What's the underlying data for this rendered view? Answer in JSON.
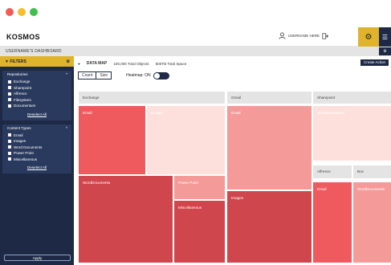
{
  "app": {
    "logo": "KOSMOS",
    "username": "USERNAME HERE",
    "dashboard_title": "USERNAME'S DASHBOARD"
  },
  "colors": {
    "navy": "#1e2a45",
    "gold": "#e0b32c",
    "red_strong": "#ef5a5f",
    "red_dark": "#cf464c",
    "red_mid": "#f1686d",
    "red_soft": "#f49a98",
    "red_pale": "#fde0dc"
  },
  "icons": {
    "user": "user-icon",
    "logout": "logout-icon",
    "gear": "gear-icon",
    "menu": "hamburger-icon",
    "filter": "funnel-icon",
    "settings_small": "settings-icon"
  },
  "sidebar": {
    "filters_label": "FILTERS",
    "repositories": {
      "title": "Repositories",
      "items": [
        "Exchange",
        "Sharepoint",
        "Alfresco",
        "Filesystem",
        "Documentum"
      ],
      "deselect": "Deselect All"
    },
    "content_types": {
      "title": "Content Types",
      "items": [
        "Email",
        "Images",
        "Word Documents",
        "Power Point",
        "Miscellaneous"
      ],
      "deselect": "Deselect All"
    },
    "apply": "Apply"
  },
  "main": {
    "datamap_title": "DATA MAP",
    "total_objects": "100,000 Total Objects",
    "total_space": "500TB Total Space",
    "create_action": "Create Action",
    "seg_count": "Count",
    "seg_size": "Size",
    "heatmap_label": "Heatmap: ON"
  },
  "treemap": {
    "groups": {
      "exchange": "Exchange",
      "gmail": "Gmail",
      "sharepoint": "Sharepoint",
      "alfresco": "Alfresco",
      "box": "Box"
    },
    "cells": {
      "ex_email": "Email",
      "ex_images": "Images",
      "ex_word": "WordDocuments",
      "ex_pp": "Power Point",
      "ex_misc": "Miscellaneous",
      "gm_email": "Email",
      "gm_images": "Images",
      "sp_word": "WordDocuments",
      "al_email": "Email",
      "box_word": "WordDocuments"
    }
  }
}
